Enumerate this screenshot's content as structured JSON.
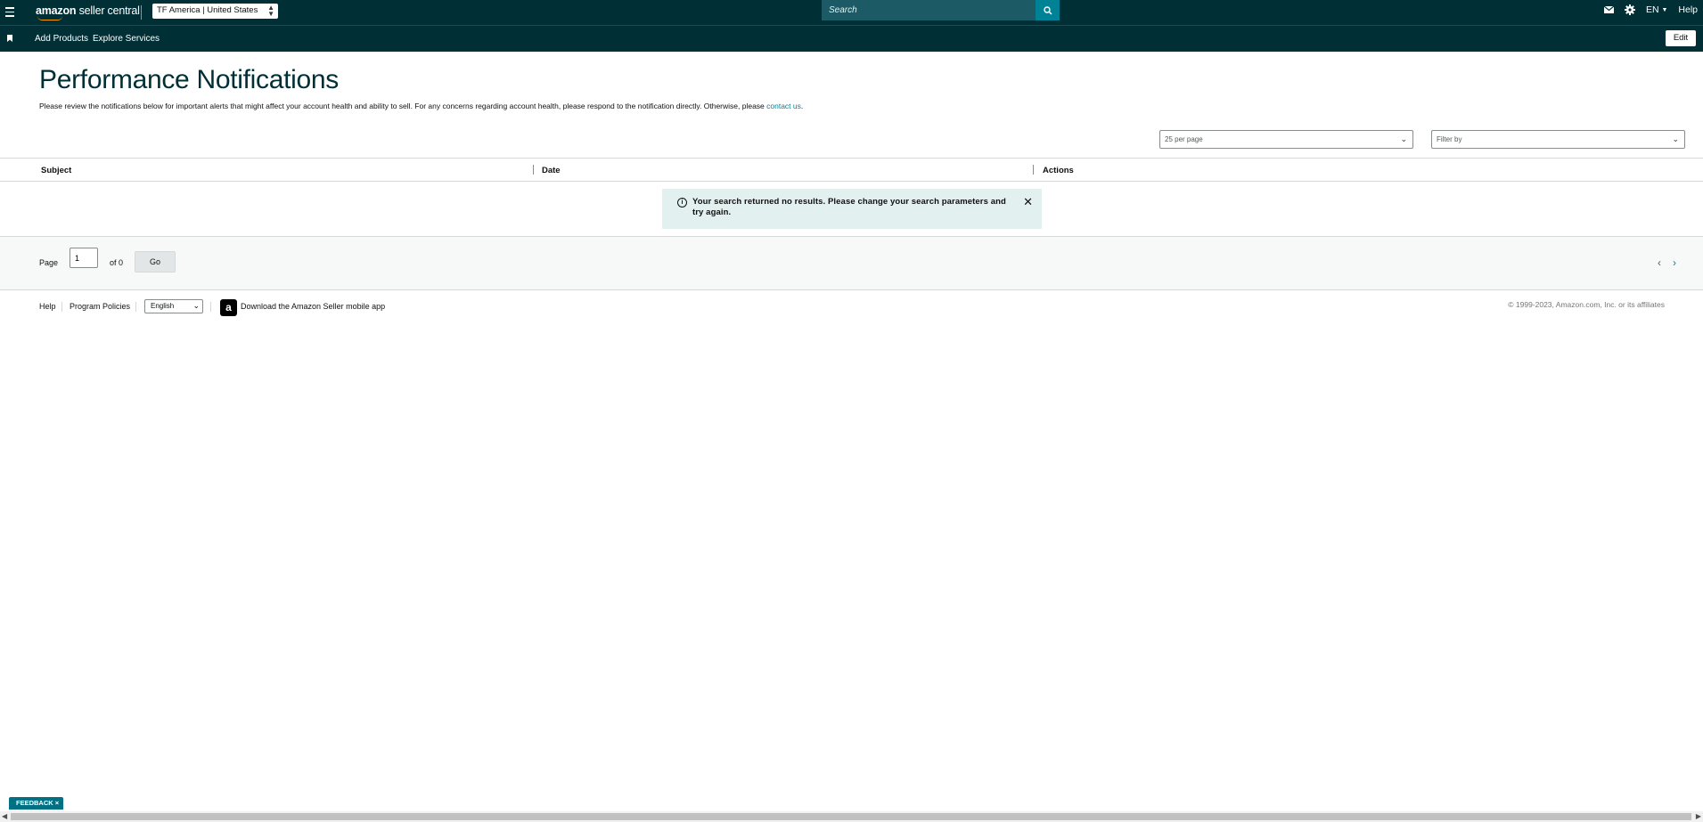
{
  "header": {
    "logo_brand": "amazon",
    "logo_suffix": " seller central",
    "account": "TF America | United States",
    "search_placeholder": "Search",
    "language": "EN",
    "help": "Help"
  },
  "bookmarks": {
    "items": [
      "Add Products",
      "Explore Services"
    ],
    "edit_label": "Edit"
  },
  "main": {
    "title": "Performance Notifications",
    "intro_text": "Please review the notifications below for important alerts that might affect your account health and ability to sell. For any concerns regarding account health, please respond to the notification directly. Otherwise, please ",
    "intro_link": "contact us",
    "intro_end": ".",
    "per_page": "25 per page",
    "filter_placeholder": "Filter by",
    "columns": [
      "Subject",
      "Date",
      "Actions"
    ],
    "alert_message": "Your search returned no results. Please change your search parameters and try again."
  },
  "pager": {
    "page_label": "Page",
    "page_value": "1",
    "of_label": "of 0",
    "go_label": "Go"
  },
  "footer": {
    "help": "Help",
    "program_policies": "Program Policies",
    "language": "English",
    "download_app": "Download the Amazon Seller mobile app",
    "copyright": "© 1999-2023, Amazon.com, Inc. or its affiliates"
  },
  "feedback": {
    "label": "FEEDBACK",
    "close": "×"
  },
  "colors": {
    "header_bg": "#002f36",
    "accent": "#008296",
    "alert_bg": "#e3f0f0"
  }
}
